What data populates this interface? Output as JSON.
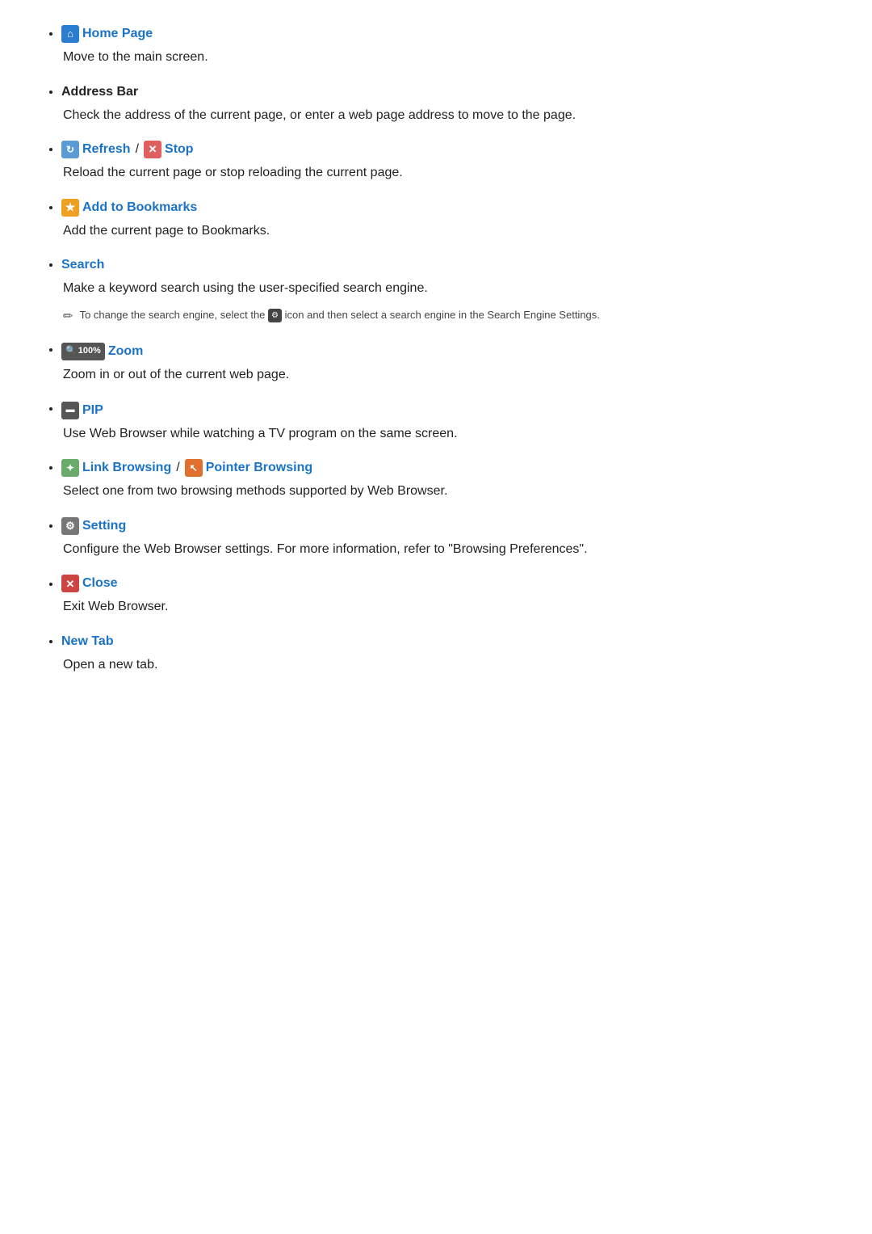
{
  "items": [
    {
      "id": "home-page",
      "icon_type": "home",
      "icon_symbol": "⌂",
      "title": "Home Page",
      "title_color": "blue",
      "desc": "Move to the main screen.",
      "note": null
    },
    {
      "id": "address-bar",
      "icon_type": null,
      "icon_symbol": null,
      "title": "Address Bar",
      "title_color": "black",
      "desc": "Check the address of the current page, or enter a web page address to move to the page.",
      "note": null
    },
    {
      "id": "refresh-stop",
      "icon_type": "refresh-stop",
      "icon_symbol_1": "↻",
      "icon_symbol_2": "✕",
      "title_1": "Refresh",
      "slash": "/",
      "title_2": "Stop",
      "title_color": "blue",
      "desc": "Reload the current page or stop reloading the current page.",
      "note": null
    },
    {
      "id": "add-bookmarks",
      "icon_type": "bookmark",
      "icon_symbol": "★",
      "title": "Add to Bookmarks",
      "title_color": "blue",
      "desc": "Add the current page to Bookmarks.",
      "note": null
    },
    {
      "id": "search",
      "icon_type": null,
      "icon_symbol": null,
      "title": "Search",
      "title_color": "blue",
      "desc": "Make a keyword search using the user-specified search engine.",
      "note": "To change the search engine, select the  icon and then select a search engine in the Search Engine Settings."
    },
    {
      "id": "zoom",
      "icon_type": "zoom",
      "icon_symbol": "🔍",
      "icon_text": "100%",
      "title": "Zoom",
      "title_color": "blue",
      "desc": "Zoom in or out of the current web page.",
      "note": null
    },
    {
      "id": "pip",
      "icon_type": "pip",
      "icon_symbol": "▬",
      "title": "PIP",
      "title_color": "blue",
      "desc": "Use Web Browser while watching a TV program on the same screen.",
      "note": null
    },
    {
      "id": "browsing",
      "icon_type": "browsing",
      "icon_symbol_1": "✦",
      "icon_symbol_2": "↖",
      "title_1": "Link Browsing",
      "slash": "/",
      "title_2": "Pointer Browsing",
      "title_color": "blue",
      "desc": "Select one from two browsing methods supported by Web Browser.",
      "note": null
    },
    {
      "id": "setting",
      "icon_type": "setting",
      "icon_symbol": "⚙",
      "title": "Setting",
      "title_color": "blue",
      "desc": "Configure the Web Browser settings. For more information, refer to \"Browsing Preferences\".",
      "note": null
    },
    {
      "id": "close",
      "icon_type": "close",
      "icon_symbol": "✕",
      "title": "Close",
      "title_color": "blue",
      "desc": "Exit Web Browser.",
      "note": null
    },
    {
      "id": "new-tab",
      "icon_type": null,
      "icon_symbol": null,
      "title": "New Tab",
      "title_color": "blue",
      "desc": "Open a new tab.",
      "note": null
    }
  ]
}
